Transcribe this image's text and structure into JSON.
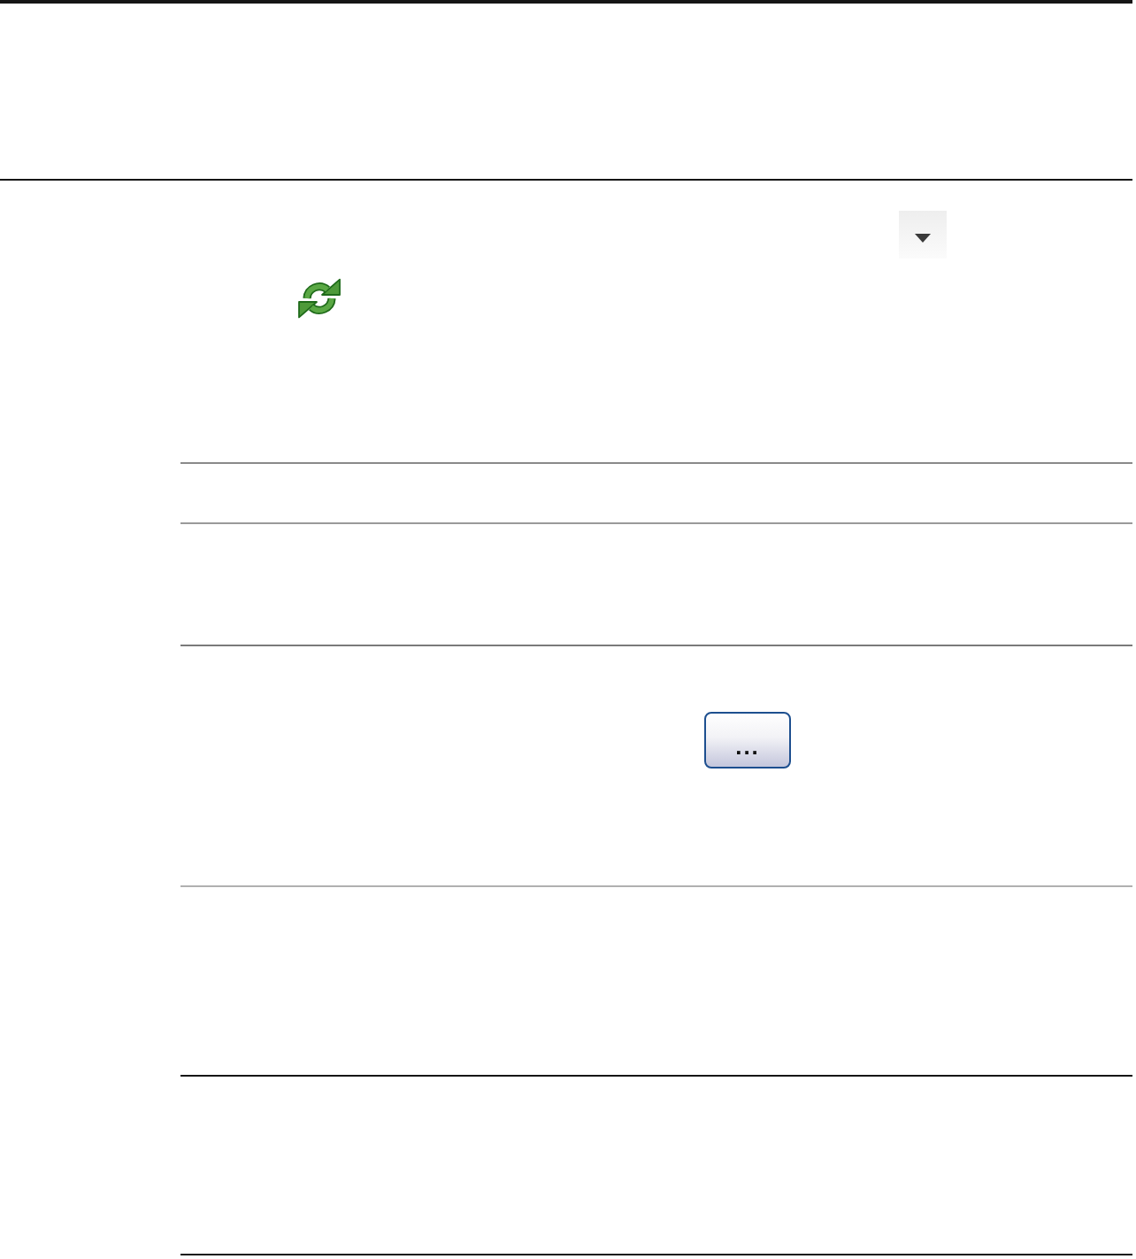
{
  "browse_button": {
    "label": "..."
  }
}
